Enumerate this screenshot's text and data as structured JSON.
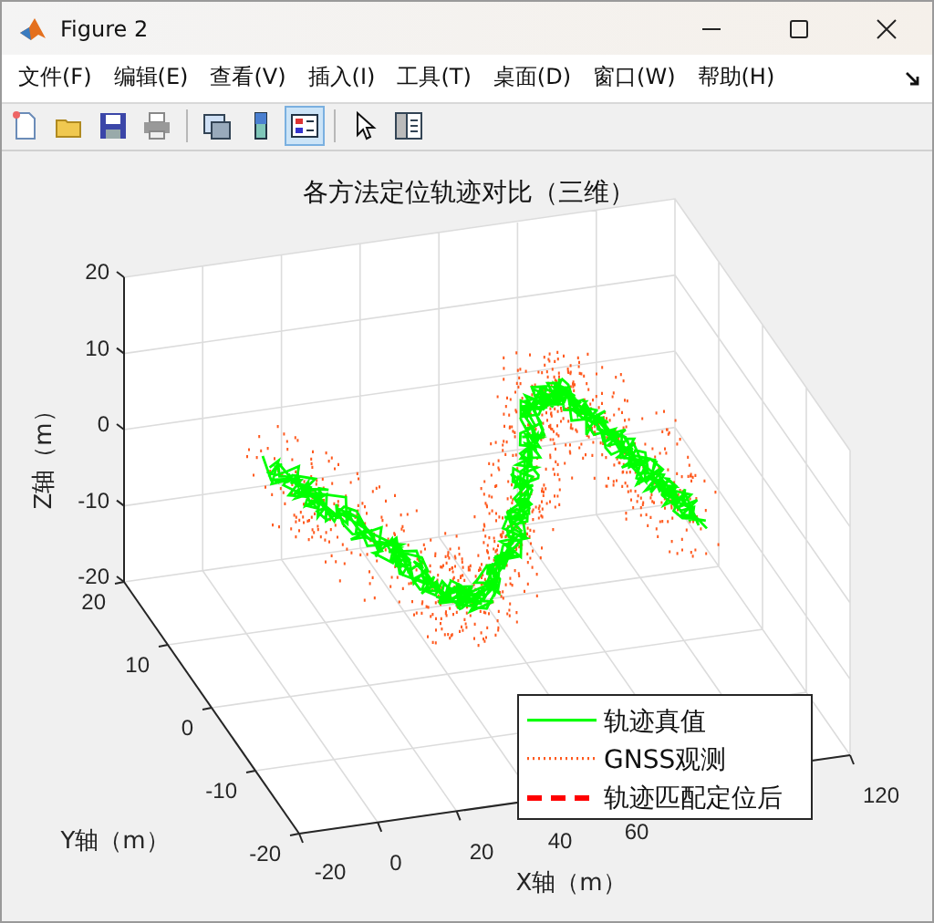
{
  "window": {
    "title": "Figure 2"
  },
  "menu": [
    "文件(F)",
    "编辑(E)",
    "查看(V)",
    "插入(I)",
    "工具(T)",
    "桌面(D)",
    "窗口(W)",
    "帮助(H)"
  ],
  "toolbar": [
    {
      "kind": "new",
      "selected": false
    },
    {
      "kind": "open",
      "selected": false
    },
    {
      "kind": "save",
      "selected": false
    },
    {
      "kind": "print",
      "selected": false
    },
    {
      "kind": "link",
      "selected": false
    },
    {
      "kind": "colorbar",
      "selected": false
    },
    {
      "kind": "legend",
      "selected": true
    },
    {
      "kind": "pointer",
      "selected": false
    },
    {
      "kind": "inspector",
      "selected": false
    }
  ],
  "plot": {
    "title": "各方法定位轨迹对比（三维）",
    "xlabel": "X轴（m）",
    "ylabel": "Y轴（m）",
    "zlabel": "Z轴（m）",
    "xticks": [
      "-20",
      "0",
      "20",
      "40",
      "60",
      "120"
    ],
    "yticks": [
      "20",
      "10",
      "0",
      "-10",
      "-20"
    ],
    "zticks": [
      "20",
      "10",
      "0",
      "-10",
      "-20"
    ],
    "legend": [
      {
        "label": "轨迹真值",
        "kind": "solid",
        "color": "#00ff00"
      },
      {
        "label": "GNSS观测",
        "kind": "dotted",
        "color": "#ff5a1f"
      },
      {
        "label": "轨迹匹配定位后",
        "kind": "dashed",
        "color": "#ff0000"
      }
    ]
  }
}
